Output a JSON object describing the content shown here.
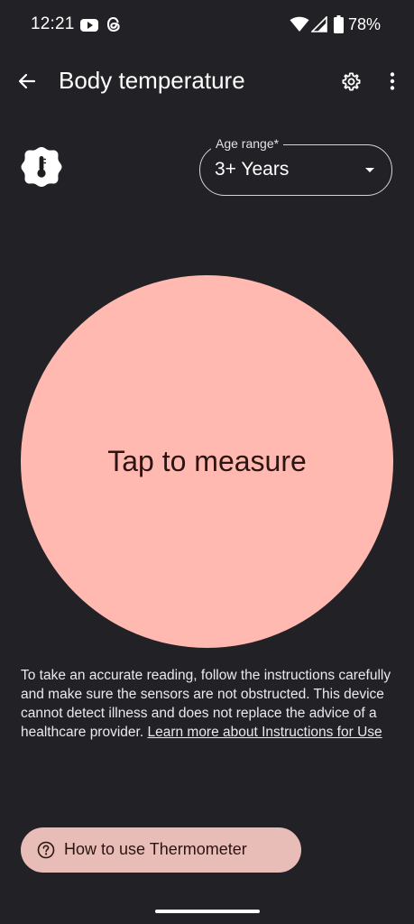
{
  "status_bar": {
    "time": "12:21",
    "battery_percent": "78%",
    "icons": [
      "youtube-icon",
      "threads-icon",
      "wifi-icon",
      "signal-icon",
      "battery-icon"
    ]
  },
  "app_bar": {
    "title": "Body temperature",
    "icons": [
      "back-arrow-icon",
      "gear-icon",
      "more-vert-icon"
    ]
  },
  "age_range": {
    "label": "Age range*",
    "selected": "3+ Years"
  },
  "measure": {
    "label": "Tap to measure"
  },
  "disclaimer": {
    "text": "To take an accurate reading, follow the instructions carefully and make sure the sensors are not obstructed. This device cannot detect illness and does not replace the advice of a healthcare provider.",
    "link": "Learn more about Instructions for Use"
  },
  "howto_button": {
    "label": "How to use Thermometer",
    "icon": "help-circle-icon"
  },
  "colors": {
    "background": "#222125",
    "circle": "#ffb9b0",
    "button": "#e9bdb7",
    "on_accent_text": "#2b1412"
  }
}
